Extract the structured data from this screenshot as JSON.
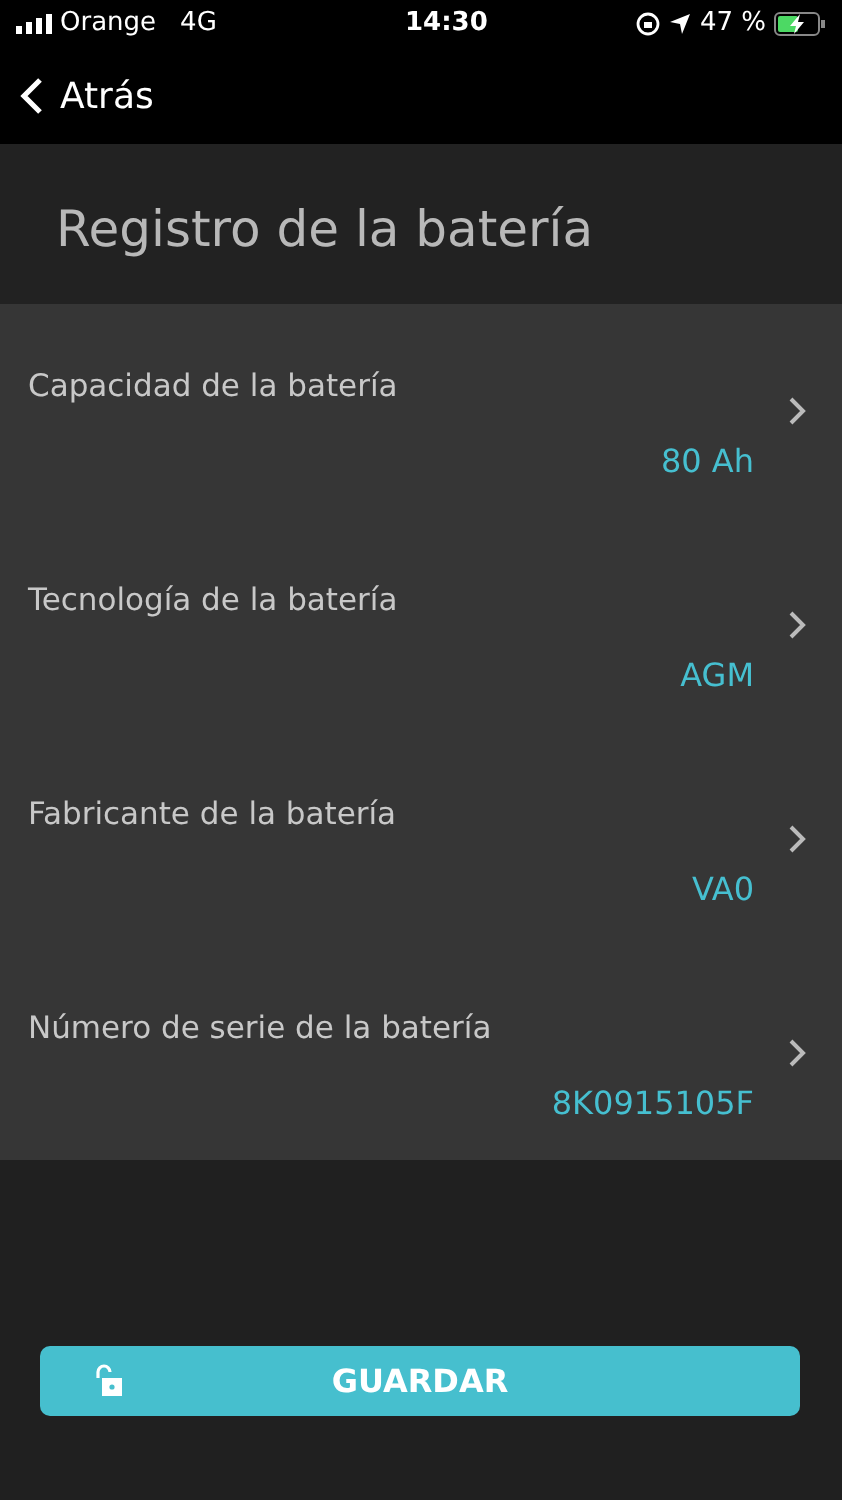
{
  "status_bar": {
    "carrier": "Orange",
    "network": "4G",
    "time": "14:30",
    "battery": "47 %"
  },
  "nav": {
    "back": "Atrás"
  },
  "title": "Registro de la batería",
  "rows": [
    {
      "label": "Capacidad de la batería",
      "value": "80 Ah"
    },
    {
      "label": "Tecnología de la batería",
      "value": "AGM"
    },
    {
      "label": "Fabricante de la batería",
      "value": "VA0"
    },
    {
      "label": "Número de serie de la batería",
      "value": "8K0915105F"
    }
  ],
  "save_button": {
    "label": "GUARDAR"
  }
}
